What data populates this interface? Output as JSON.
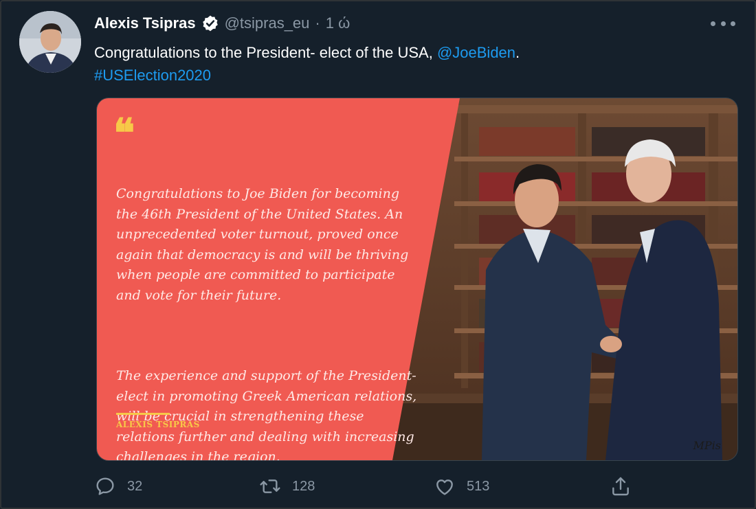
{
  "tweet": {
    "author_name": "Alexis Tsipras",
    "handle": "@tsipras_eu",
    "separator": "·",
    "time": "1 ώ",
    "text_prefix": "Congratulations to the President- elect of the USA, ",
    "mention": "@JoeBiden",
    "text_suffix": ".",
    "hashtag": "#USElection2020"
  },
  "card": {
    "quote_mark": "❝",
    "paragraph_1": "Congratulations to Joe Biden for becoming the 46th President of the United States. An unprecedented voter turnout, proved once again that democracy is and will be thriving when people are committed to participate and vote for their future.",
    "paragraph_2": "The experience and support of the President-elect in promoting Greek American relations, will be crucial in strengthening these relations further and dealing with increasing challenges in the region.",
    "signature": "ALEXIS TSIPRAS",
    "watermark": "MPis"
  },
  "actions": {
    "replies": "32",
    "retweets": "128",
    "likes": "513"
  },
  "icons": {
    "verified": "verified-badge-icon",
    "more": "more-options-icon",
    "reply": "reply-icon",
    "retweet": "retweet-icon",
    "like": "heart-icon",
    "share": "share-icon"
  },
  "colors": {
    "background": "#15202b",
    "link": "#1d9bf0",
    "muted": "#8b98a5",
    "card_red": "#f05a52",
    "accent_yellow": "#f7c948"
  }
}
